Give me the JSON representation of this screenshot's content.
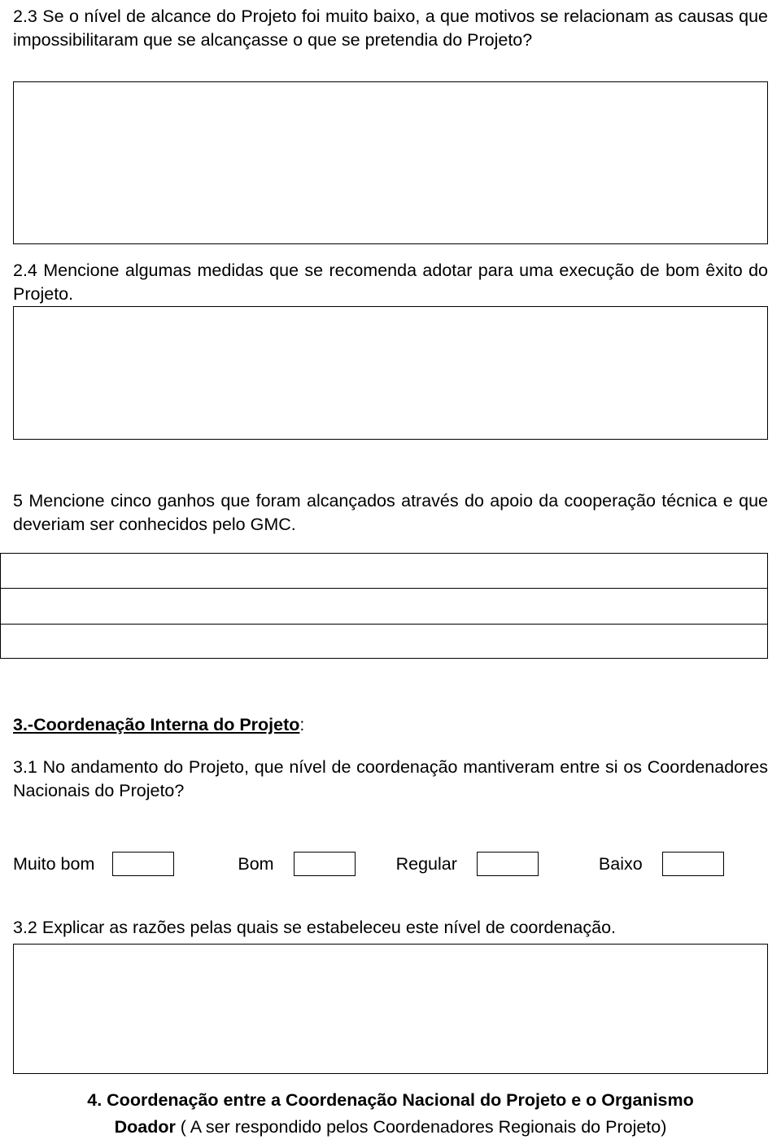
{
  "document": {
    "questions": {
      "q23": "2.3 Se o  nível de alcance do Projeto foi muito baixo,  a que motivos se relacionam as causas que impossibilitaram que se alcançasse o que se pretendia do Projeto?",
      "q24": "2.4 Mencione algumas medidas que se recomenda adotar para uma execução de bom êxito do Projeto.",
      "q5": "5  Mencione cinco ganhos que foram alcançados através do apoio da cooperação técnica e que deveriam ser conhecidos pelo GMC.",
      "section3_heading": "3.-Coordenação Interna do Projeto",
      "section3_heading_colon": ":",
      "q31": "3.1 No andamento do Projeto, que nível de coordenação mantiveram entre si os Coordenadores  Nacionais do Projeto?",
      "q32": "3.2 Explicar as razões pelas quais se estabeleceu este nível de coordenação.",
      "section4_line1": "4. Coordenação entre a Coordenação  Nacional do Projeto e o Organismo",
      "section4_line2_bold": "Doador",
      "section4_line2_rest": " ( A ser respondido pelos  Coordenadores  Regionais do Projeto",
      "section4_line2_close": ")"
    },
    "rating_scale": {
      "options": [
        {
          "label": "Muito bom",
          "value": ""
        },
        {
          "label": "Bom",
          "value": ""
        },
        {
          "label": "Regular",
          "value": ""
        },
        {
          "label": "Baixo",
          "value": ""
        }
      ]
    }
  }
}
